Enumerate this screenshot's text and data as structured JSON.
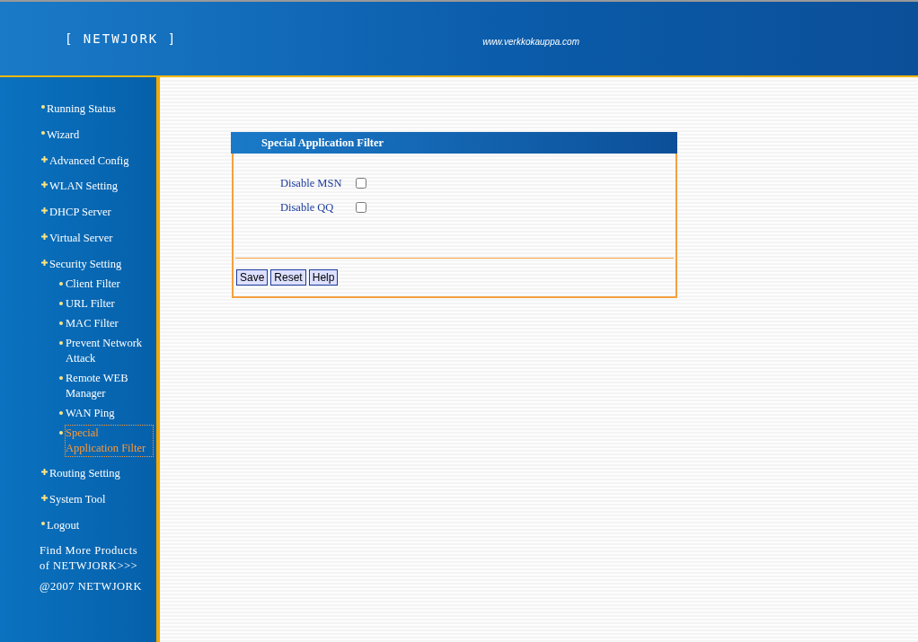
{
  "header": {
    "logo": "[ NETWJORK ]",
    "url": "www.verkkokauppa.com"
  },
  "menu": [
    {
      "label": "Running Status",
      "kind": "dot",
      "selected": false
    },
    {
      "label": "Wizard",
      "kind": "dot",
      "selected": false
    },
    {
      "label": "Advanced Config",
      "kind": "plus",
      "selected": false
    },
    {
      "label": "WLAN Setting",
      "kind": "plus",
      "selected": false
    },
    {
      "label": "DHCP Server",
      "kind": "plus",
      "selected": false
    },
    {
      "label": "Virtual Server",
      "kind": "plus",
      "selected": false
    },
    {
      "label": "Security Setting",
      "kind": "plus",
      "selected": false,
      "children": [
        {
          "label": "Client Filter",
          "selected": false
        },
        {
          "label": "URL Filter",
          "selected": false
        },
        {
          "label": "MAC Filter",
          "selected": false
        },
        {
          "label": "Prevent Network Attack",
          "selected": false
        },
        {
          "label": "Remote WEB Manager",
          "selected": false
        },
        {
          "label": "WAN Ping",
          "selected": false
        },
        {
          "label": "Special Application Filter",
          "selected": true
        }
      ]
    },
    {
      "label": "Routing Setting",
      "kind": "plus",
      "selected": false
    },
    {
      "label": "System Tool",
      "kind": "plus",
      "selected": false
    },
    {
      "label": "Logout",
      "kind": "dot",
      "selected": false
    }
  ],
  "sidebar_footer": {
    "link": "Find More Products of NETWJORK>>>",
    "copyright": "@2007 NETWJORK"
  },
  "panel": {
    "title": "Special Application Filter",
    "options": [
      {
        "label": "Disable MSN",
        "checked": false
      },
      {
        "label": "Disable QQ",
        "checked": false
      }
    ],
    "buttons": [
      "Save",
      "Reset",
      "Help"
    ]
  }
}
